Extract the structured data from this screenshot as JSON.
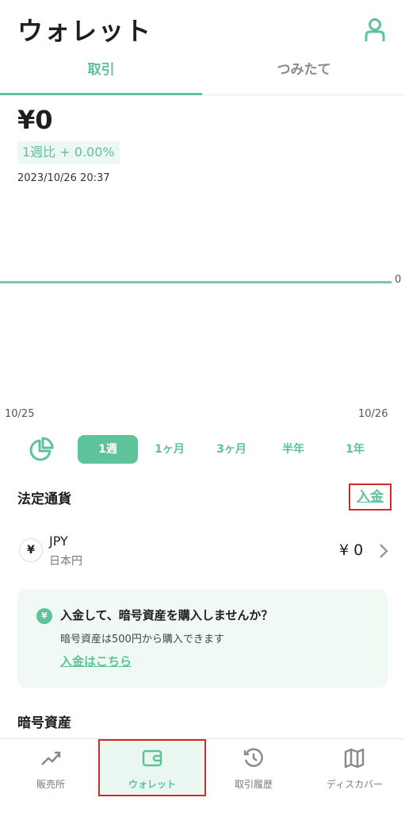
{
  "header": {
    "title": "ウォレット",
    "profile_icon": "person-icon"
  },
  "tabs": [
    {
      "label": "取引",
      "active": true
    },
    {
      "label": "つみたて",
      "active": false
    }
  ],
  "summary": {
    "balance": "¥0",
    "change": "1週比 + 0.00%",
    "timestamp": "2023/10/26 20:37"
  },
  "chart": {
    "y_value_label": "0",
    "x_start": "10/25",
    "x_end": "10/26",
    "line_color": "#74c9a4"
  },
  "periods": {
    "pie_icon": "pie-chart-icon",
    "items": [
      {
        "label": "1週",
        "active": true
      },
      {
        "label": "1ヶ月"
      },
      {
        "label": "3ヶ月"
      },
      {
        "label": "半年"
      },
      {
        "label": "1年"
      }
    ]
  },
  "fiat": {
    "title": "法定通貨",
    "deposit_label": "入金",
    "currency": {
      "symbol": "¥",
      "code": "JPY",
      "name": "日本円",
      "amount": "¥ 0"
    }
  },
  "promo": {
    "icon": "¥",
    "title": "入金して、暗号資産を購入しませんか？",
    "subtitle": "暗号資産は500円から購入できます",
    "link": "入金はこちら"
  },
  "crypto": {
    "title": "暗号資産"
  },
  "bottom_nav": [
    {
      "label": "販売所",
      "icon": "trend-chart-icon"
    },
    {
      "label": "ウォレット",
      "icon": "wallet-icon",
      "active": true
    },
    {
      "label": "取引履歴",
      "icon": "history-icon"
    },
    {
      "label": "ディスカバー",
      "icon": "map-icon"
    }
  ],
  "colors": {
    "accent": "#5cc39a",
    "highlight_border": "#d02a2a"
  }
}
